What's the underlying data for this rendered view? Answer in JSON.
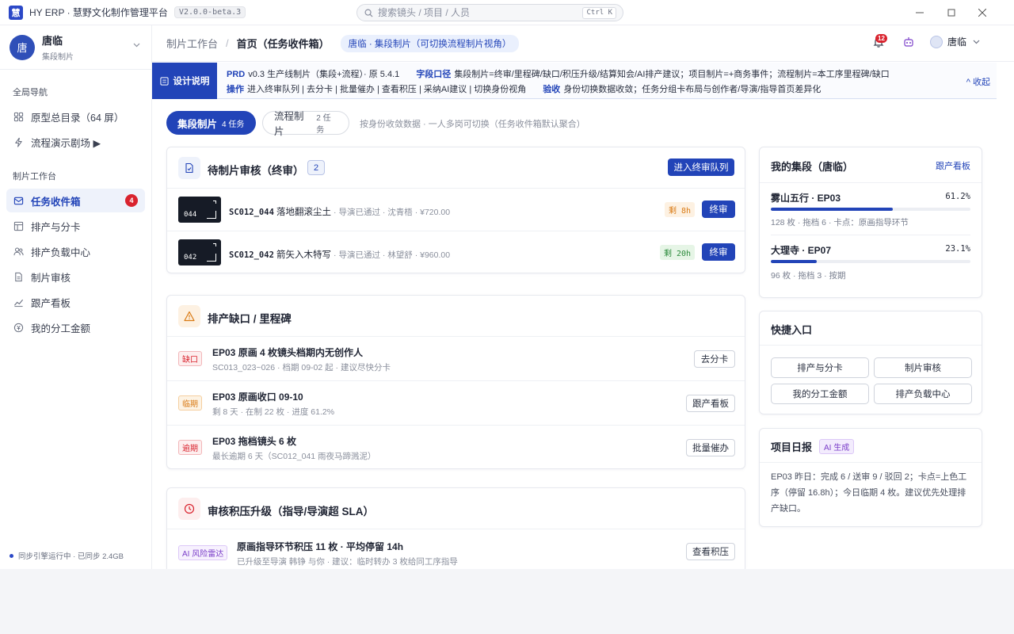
{
  "app": {
    "logo_text": "慧",
    "title": "HY ERP · 慧野文化制作管理平台",
    "version": "V2.0.0-beta.3"
  },
  "search": {
    "placeholder": "搜索镜头 / 项目 / 人员",
    "shortcut": "Ctrl K"
  },
  "user": {
    "avatar_text": "唐",
    "name": "唐临",
    "role": "集段制片"
  },
  "sidebar": {
    "section_global": "全局导航",
    "global_items": [
      {
        "label": "原型总目录（64 屏）",
        "icon": "grid-icon"
      },
      {
        "label": "流程演示剧场 ▶",
        "icon": "bolt-icon"
      }
    ],
    "section_workspace": "制片工作台",
    "workspace_items": [
      {
        "label": "任务收件箱",
        "icon": "inbox-icon",
        "badge": "4"
      },
      {
        "label": "排产与分卡",
        "icon": "layout-icon"
      },
      {
        "label": "排产负载中心",
        "icon": "users-icon"
      },
      {
        "label": "制片审核",
        "icon": "document-icon"
      },
      {
        "label": "跟产看板",
        "icon": "trend-icon"
      },
      {
        "label": "我的分工金额",
        "icon": "coin-icon"
      }
    ],
    "sync_status": "同步引擎运行中 · 已同步 2.4GB"
  },
  "header": {
    "breadcrumb_root": "制片工作台",
    "breadcrumb_current": "首页（任务收件箱）",
    "role_pill": "唐临 · 集段制片（可切换流程制片视角）",
    "notification_count": "12",
    "username": "唐临"
  },
  "design_note": {
    "tab_label": "设计说明",
    "line1_prd_label": "PRD",
    "line1_prd_text": "v0.3 生产线制片（集段+流程）· 原 5.4.1",
    "line1_field_label": "字段口径",
    "line1_field_text": "集段制片=终审/里程碑/缺口/积压升级/结算知会/AI排产建议；项目制片=+商务事件；流程制片=本工序里程碑/缺口",
    "line2_ops_label": "操作",
    "line2_ops_text": "进入终审队列 | 去分卡 | 批量催办 | 查看积压 | 采纳AI建议 | 切换身份视角",
    "line2_accept_label": "验收",
    "line2_accept_text": "身份切换数据收敛；任务分组卡布局与创作者/导演/指导首页差异化",
    "collapse_label": "^ 收起"
  },
  "filters": {
    "chips": [
      {
        "label": "集段制片",
        "count": "4 任务"
      },
      {
        "label": "流程制片",
        "count": "2 任务"
      }
    ],
    "hint": "按身份收敛数据 · 一人多岗可切换（任务收件箱默认聚合）"
  },
  "review_card": {
    "title": "待制片审核（终审）",
    "count": "2",
    "action": "进入终审队列",
    "rows": [
      {
        "thumb": "044",
        "code": "SC012_044",
        "name": "落地翻滚尘土",
        "meta": "· 导演已通过 · 沈青梧 · ¥720.00",
        "remain": "剩 8h",
        "action": "终审"
      },
      {
        "thumb": "042",
        "code": "SC012_042",
        "name": "箭矢入木特写",
        "meta": "· 导演已通过 · 林望舒 · ¥960.00",
        "remain": "剩 20h",
        "action": "终审"
      }
    ]
  },
  "gap_card": {
    "title": "排产缺口 / 里程碑",
    "rows": [
      {
        "tag": "缺口",
        "title": "EP03 原画 4 枚镜头档期内无创作人",
        "sub": "SC013_023~026 · 档期 09-02 起 · 建议尽快分卡",
        "action": "去分卡"
      },
      {
        "tag": "临期",
        "title": "EP03 原画收口 09-10",
        "sub": "剩 8 天 · 在制 22 枚 · 进度 61.2%",
        "action": "跟产看板"
      },
      {
        "tag": "逾期",
        "title": "EP03 拖档镜头 6 枚",
        "sub": "最长逾期 6 天（SC012_041 雨夜马蹄溅泥）",
        "action": "批量催办"
      }
    ]
  },
  "backlog_card": {
    "title": "审核积压升级（指导/导演超 SLA）",
    "row": {
      "tag": "AI 风险雷达",
      "title": "原画指导环节积压 11 枚 · 平均停留 14h",
      "sub": "已升级至导演 韩铮 与你 · 建议：临时转办 3 枚给同工序指导",
      "action": "查看积压"
    }
  },
  "my_episodes": {
    "title": "我的集段（唐临）",
    "link": "跟产看板",
    "items": [
      {
        "title": "雾山五行 · EP03",
        "percent": "61.2%",
        "progress": 0.612,
        "sub": "128 枚 · 拖档 6 · 卡点：原画指导环节"
      },
      {
        "title": "大理寺 · EP07",
        "percent": "23.1%",
        "progress": 0.231,
        "sub": "96 枚 · 拖档 3 · 按期"
      }
    ]
  },
  "quick_entry": {
    "title": "快捷入口",
    "buttons": [
      "排产与分卡",
      "制片审核",
      "我的分工金额",
      "排产负载中心"
    ]
  },
  "daily_report": {
    "title": "项目日报",
    "ai_tag": "AI 生成",
    "text": "EP03 昨日：完成 6 / 送审 9 / 驳回 2；卡点=上色工序（停留 16.8h）；今日临期 4 枚。建议优先处理排产缺口。"
  },
  "colors": {
    "accent": "#2244b8",
    "danger": "#d9232e",
    "warning": "#d97a14",
    "success": "#2a8a3a",
    "ai": "#7b3fc9"
  }
}
